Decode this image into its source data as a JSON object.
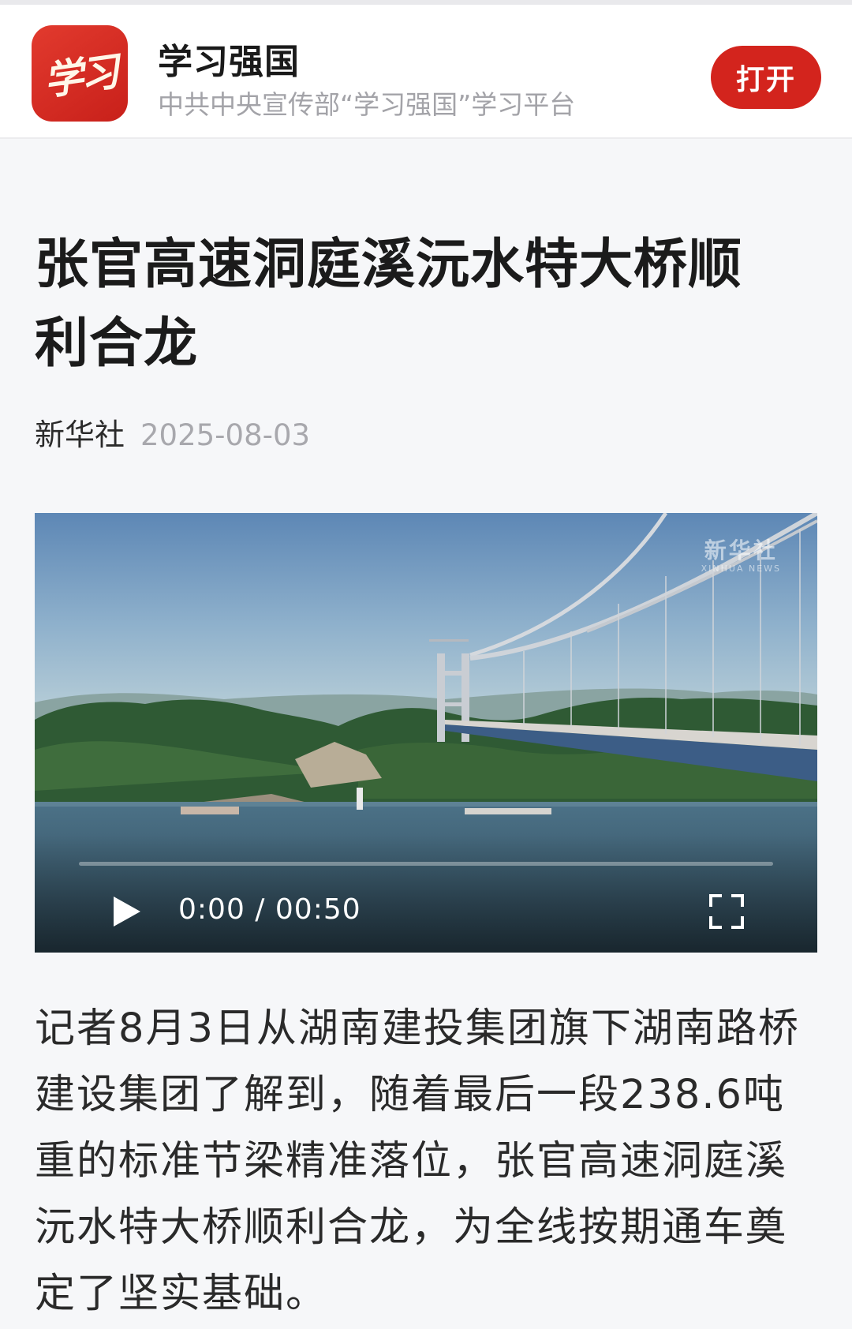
{
  "banner": {
    "logo_text": "学习",
    "app_name": "学习强国",
    "app_desc": "中共中央宣传部“学习强国”学习平台",
    "open_label": "打开"
  },
  "article": {
    "title": "张官高速洞庭溪沅水特大桥顺利合龙",
    "source": "新华社",
    "date": "2025-08-03",
    "body": "记者8月3日从湖南建投集团旗下湖南路桥建设集团了解到，随着最后一段238.6吨重的标准节梁精准落位，张官高速洞庭溪沅水特大桥顺利合龙，为全线按期通车奠定了坚实基础。"
  },
  "video": {
    "watermark_main": "新华社",
    "watermark_sub": "XINHUA NEWS",
    "current_time": "0:00",
    "separator": "/",
    "duration": "00:50",
    "progress_fraction": 0.0,
    "play_icon": "play-icon",
    "fullscreen_icon": "fullscreen-icon"
  },
  "colors": {
    "brand_red": "#d3241d",
    "background": "#f6f7f9"
  }
}
